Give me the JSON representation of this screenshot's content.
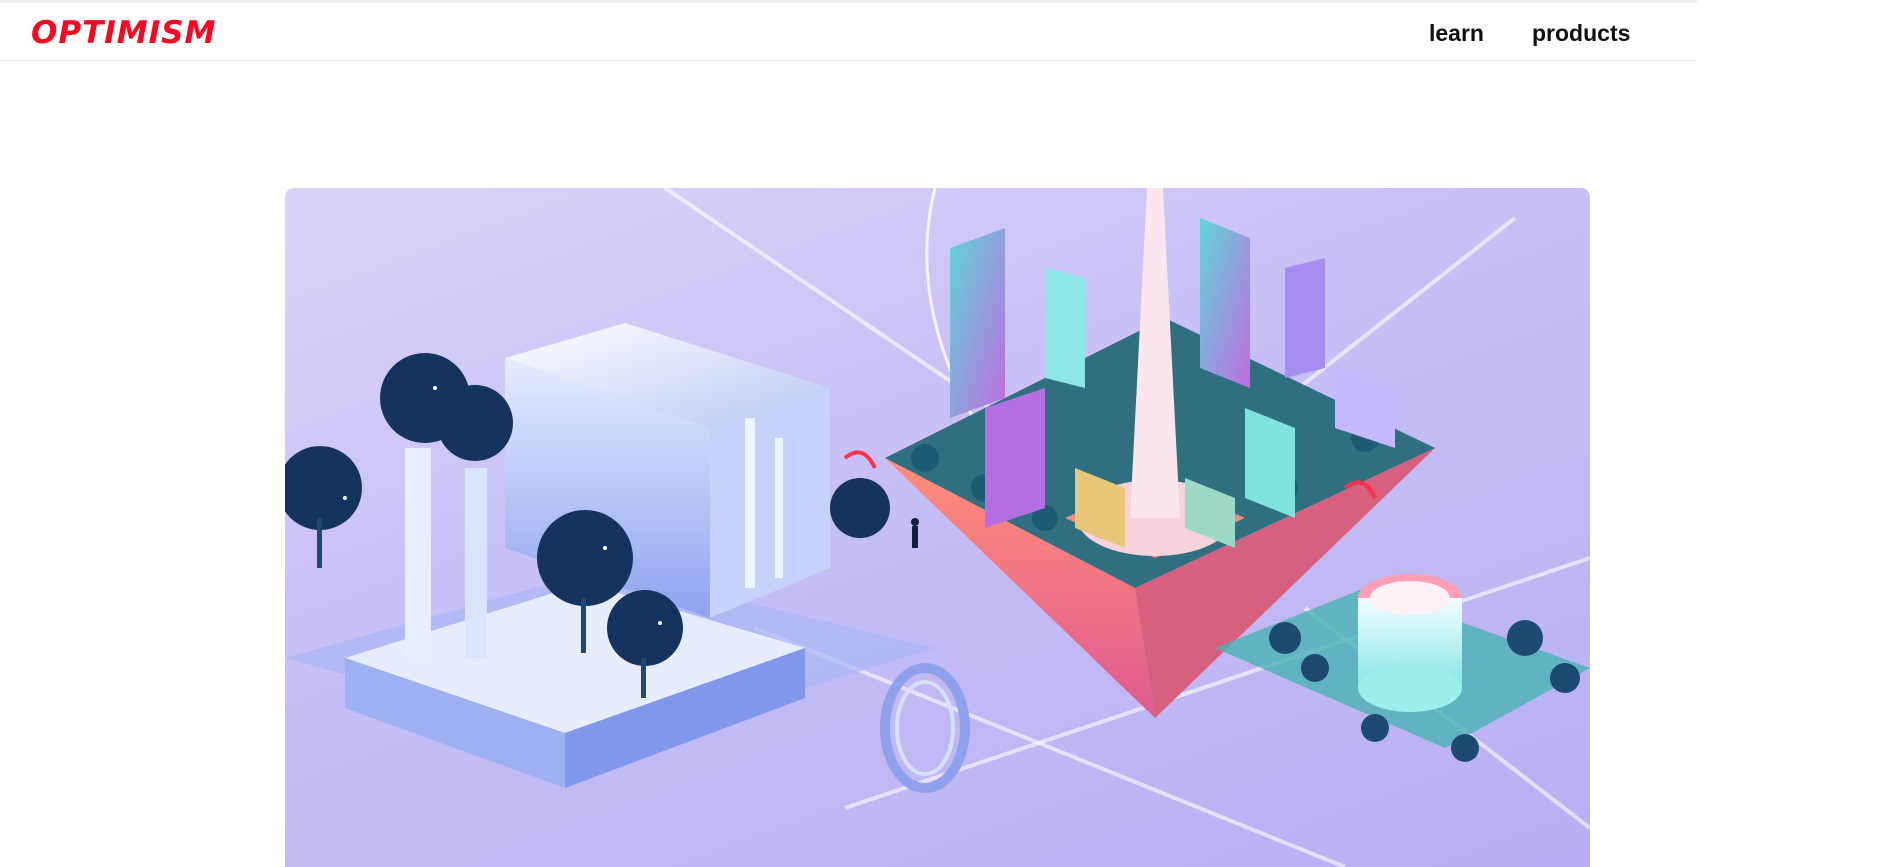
{
  "brand": {
    "logo_text": "OPTIMISM",
    "color": "#ff0420"
  },
  "nav": {
    "items": [
      {
        "label": "learn"
      },
      {
        "label": "products"
      }
    ]
  },
  "hero": {
    "image_icon": "isometric-city-illustration"
  }
}
